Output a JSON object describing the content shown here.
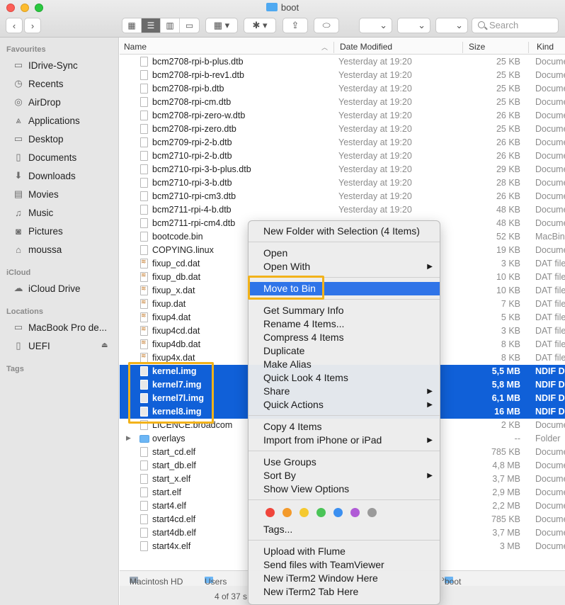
{
  "window": {
    "title": "boot"
  },
  "toolbar": {
    "search_placeholder": "Search",
    "view_icons": [
      "icon-view-icon",
      "list-view-icon",
      "column-view-icon",
      "gallery-view-icon"
    ]
  },
  "sidebar": {
    "favourites_label": "Favourites",
    "favourites": [
      "IDrive-Sync",
      "Recents",
      "AirDrop",
      "Applications",
      "Desktop",
      "Documents",
      "Downloads",
      "Movies",
      "Music",
      "Pictures",
      "moussa"
    ],
    "icloud_label": "iCloud",
    "icloud": [
      "iCloud Drive"
    ],
    "locations_label": "Locations",
    "locations": [
      "MacBook Pro de...",
      "UEFI"
    ],
    "tags_label": "Tags"
  },
  "columns": {
    "name": "Name",
    "date": "Date Modified",
    "size": "Size",
    "kind": "Kind"
  },
  "files": [
    {
      "name": "bcm2708-rpi-b-plus.dtb",
      "date": "Yesterday at 19:20",
      "size": "25 KB",
      "kind": "Docume"
    },
    {
      "name": "bcm2708-rpi-b-rev1.dtb",
      "date": "Yesterday at 19:20",
      "size": "25 KB",
      "kind": "Docume"
    },
    {
      "name": "bcm2708-rpi-b.dtb",
      "date": "Yesterday at 19:20",
      "size": "25 KB",
      "kind": "Docume"
    },
    {
      "name": "bcm2708-rpi-cm.dtb",
      "date": "Yesterday at 19:20",
      "size": "25 KB",
      "kind": "Docume"
    },
    {
      "name": "bcm2708-rpi-zero-w.dtb",
      "date": "Yesterday at 19:20",
      "size": "26 KB",
      "kind": "Docume"
    },
    {
      "name": "bcm2708-rpi-zero.dtb",
      "date": "Yesterday at 19:20",
      "size": "25 KB",
      "kind": "Docume"
    },
    {
      "name": "bcm2709-rpi-2-b.dtb",
      "date": "Yesterday at 19:20",
      "size": "26 KB",
      "kind": "Docume"
    },
    {
      "name": "bcm2710-rpi-2-b.dtb",
      "date": "Yesterday at 19:20",
      "size": "26 KB",
      "kind": "Docume"
    },
    {
      "name": "bcm2710-rpi-3-b-plus.dtb",
      "date": "Yesterday at 19:20",
      "size": "29 KB",
      "kind": "Docume"
    },
    {
      "name": "bcm2710-rpi-3-b.dtb",
      "date": "Yesterday at 19:20",
      "size": "28 KB",
      "kind": "Docume"
    },
    {
      "name": "bcm2710-rpi-cm3.dtb",
      "date": "Yesterday at 19:20",
      "size": "26 KB",
      "kind": "Docume"
    },
    {
      "name": "bcm2711-rpi-4-b.dtb",
      "date": "Yesterday at 19:20",
      "size": "48 KB",
      "kind": "Docume"
    },
    {
      "name": "bcm2711-rpi-cm4.dtb",
      "date": "",
      "size": "48 KB",
      "kind": "Docume"
    },
    {
      "name": "bootcode.bin",
      "date": "",
      "size": "52 KB",
      "kind": "MacBin"
    },
    {
      "name": "COPYING.linux",
      "date": "",
      "size": "19 KB",
      "kind": "Docume"
    },
    {
      "name": "fixup_cd.dat",
      "date": "",
      "size": "3 KB",
      "kind": "DAT file"
    },
    {
      "name": "fixup_db.dat",
      "date": "",
      "size": "10 KB",
      "kind": "DAT file"
    },
    {
      "name": "fixup_x.dat",
      "date": "",
      "size": "10 KB",
      "kind": "DAT file"
    },
    {
      "name": "fixup.dat",
      "date": "",
      "size": "7 KB",
      "kind": "DAT file"
    },
    {
      "name": "fixup4.dat",
      "date": "",
      "size": "5 KB",
      "kind": "DAT file"
    },
    {
      "name": "fixup4cd.dat",
      "date": "",
      "size": "3 KB",
      "kind": "DAT file"
    },
    {
      "name": "fixup4db.dat",
      "date": "",
      "size": "8 KB",
      "kind": "DAT file"
    },
    {
      "name": "fixup4x.dat",
      "date": "",
      "size": "8 KB",
      "kind": "DAT file"
    },
    {
      "name": "kernel.img",
      "date": "",
      "size": "5,5 MB",
      "kind": "NDIF D",
      "selected": true
    },
    {
      "name": "kernel7.img",
      "date": "",
      "size": "5,8 MB",
      "kind": "NDIF D",
      "selected": true
    },
    {
      "name": "kernel7l.img",
      "date": "",
      "size": "6,1 MB",
      "kind": "NDIF D",
      "selected": true
    },
    {
      "name": "kernel8.img",
      "date": "",
      "size": "16 MB",
      "kind": "NDIF D",
      "selected": true
    },
    {
      "name": "LICENCE.broadcom",
      "date": "",
      "size": "2 KB",
      "kind": "Docume"
    },
    {
      "name": "overlays",
      "date": "",
      "size": "--",
      "kind": "Folder",
      "folder": true
    },
    {
      "name": "start_cd.elf",
      "date": "",
      "size": "785 KB",
      "kind": "Docume"
    },
    {
      "name": "start_db.elf",
      "date": "",
      "size": "4,8 MB",
      "kind": "Docume"
    },
    {
      "name": "start_x.elf",
      "date": "",
      "size": "3,7 MB",
      "kind": "Docume"
    },
    {
      "name": "start.elf",
      "date": "",
      "size": "2,9 MB",
      "kind": "Docume"
    },
    {
      "name": "start4.elf",
      "date": "",
      "size": "2,2 MB",
      "kind": "Docume"
    },
    {
      "name": "start4cd.elf",
      "date": "",
      "size": "785 KB",
      "kind": "Docume"
    },
    {
      "name": "start4db.elf",
      "date": "",
      "size": "3,7 MB",
      "kind": "Docume"
    },
    {
      "name": "start4x.elf",
      "date": "",
      "size": "3 MB",
      "kind": "Docume"
    }
  ],
  "pathbar": {
    "disk": "Macintosh HD",
    "users": "Users",
    "current": "boot"
  },
  "status": {
    "text": "4 of 37 s"
  },
  "context_menu": {
    "new_folder": "New Folder with Selection (4 Items)",
    "open": "Open",
    "open_with": "Open With",
    "move_to_bin": "Move to Bin",
    "get_summary_info": "Get Summary Info",
    "rename": "Rename 4 Items...",
    "compress": "Compress 4 Items",
    "duplicate": "Duplicate",
    "make_alias": "Make Alias",
    "quick_look": "Quick Look 4 Items",
    "share": "Share",
    "quick_actions": "Quick Actions",
    "copy": "Copy 4 Items",
    "import_iphone": "Import from iPhone or iPad",
    "use_groups": "Use Groups",
    "sort_by": "Sort By",
    "show_view_options": "Show View Options",
    "tags": "Tags...",
    "upload_flume": "Upload with Flume",
    "send_teamviewer": "Send files with TeamViewer",
    "new_iterm_window": "New iTerm2 Window Here",
    "new_iterm_tab": "New iTerm2 Tab Here",
    "tag_colors": [
      "#f0453b",
      "#f39a2b",
      "#f5c92f",
      "#4ac457",
      "#3b8ff0",
      "#b05bd6",
      "#9a9a9a"
    ]
  }
}
